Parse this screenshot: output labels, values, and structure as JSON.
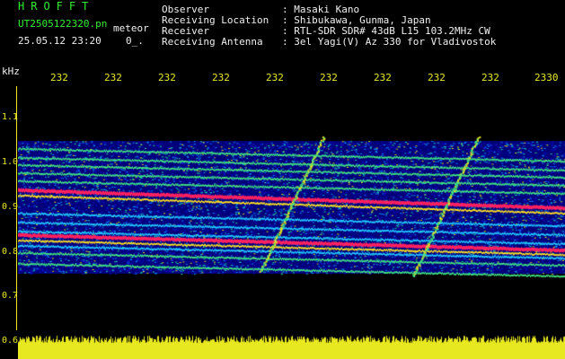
{
  "header": {
    "app_title": "HROFFT",
    "file_name": "UT2505122320.pn",
    "meteor_label": "meteor",
    "date_time": "25.05.12 23:20",
    "extra_field": "0_."
  },
  "info": [
    {
      "label": "Observer",
      "value": ": Masaki Kano"
    },
    {
      "label": "Receiving Location",
      "value": ": Shibukawa, Gunma, Japan"
    },
    {
      "label": "Receiver",
      "value": ": RTL-SDR SDR# 43dB L15 103.2MHz CW"
    },
    {
      "label": "Receiving Antenna",
      "value": ": 3el Yagi(V) Az 330 for Vladivostok"
    }
  ],
  "axis": {
    "unit_label": "kHz",
    "time_ticks": [
      "232",
      "232",
      "232",
      "232",
      "232",
      "232",
      "232",
      "232",
      "232",
      "2330"
    ],
    "freq_ticks": [
      "1.1",
      "1.0",
      "0.9",
      "0.8",
      "0.7",
      "0.6"
    ]
  },
  "colors": {
    "text_primary": "#f0f0f0",
    "title_green": "#33ee33",
    "axis_yellow": "#e8e820",
    "background": "#000000",
    "noise_floor": "#00007a",
    "signal_hot": "#ff2060"
  }
}
